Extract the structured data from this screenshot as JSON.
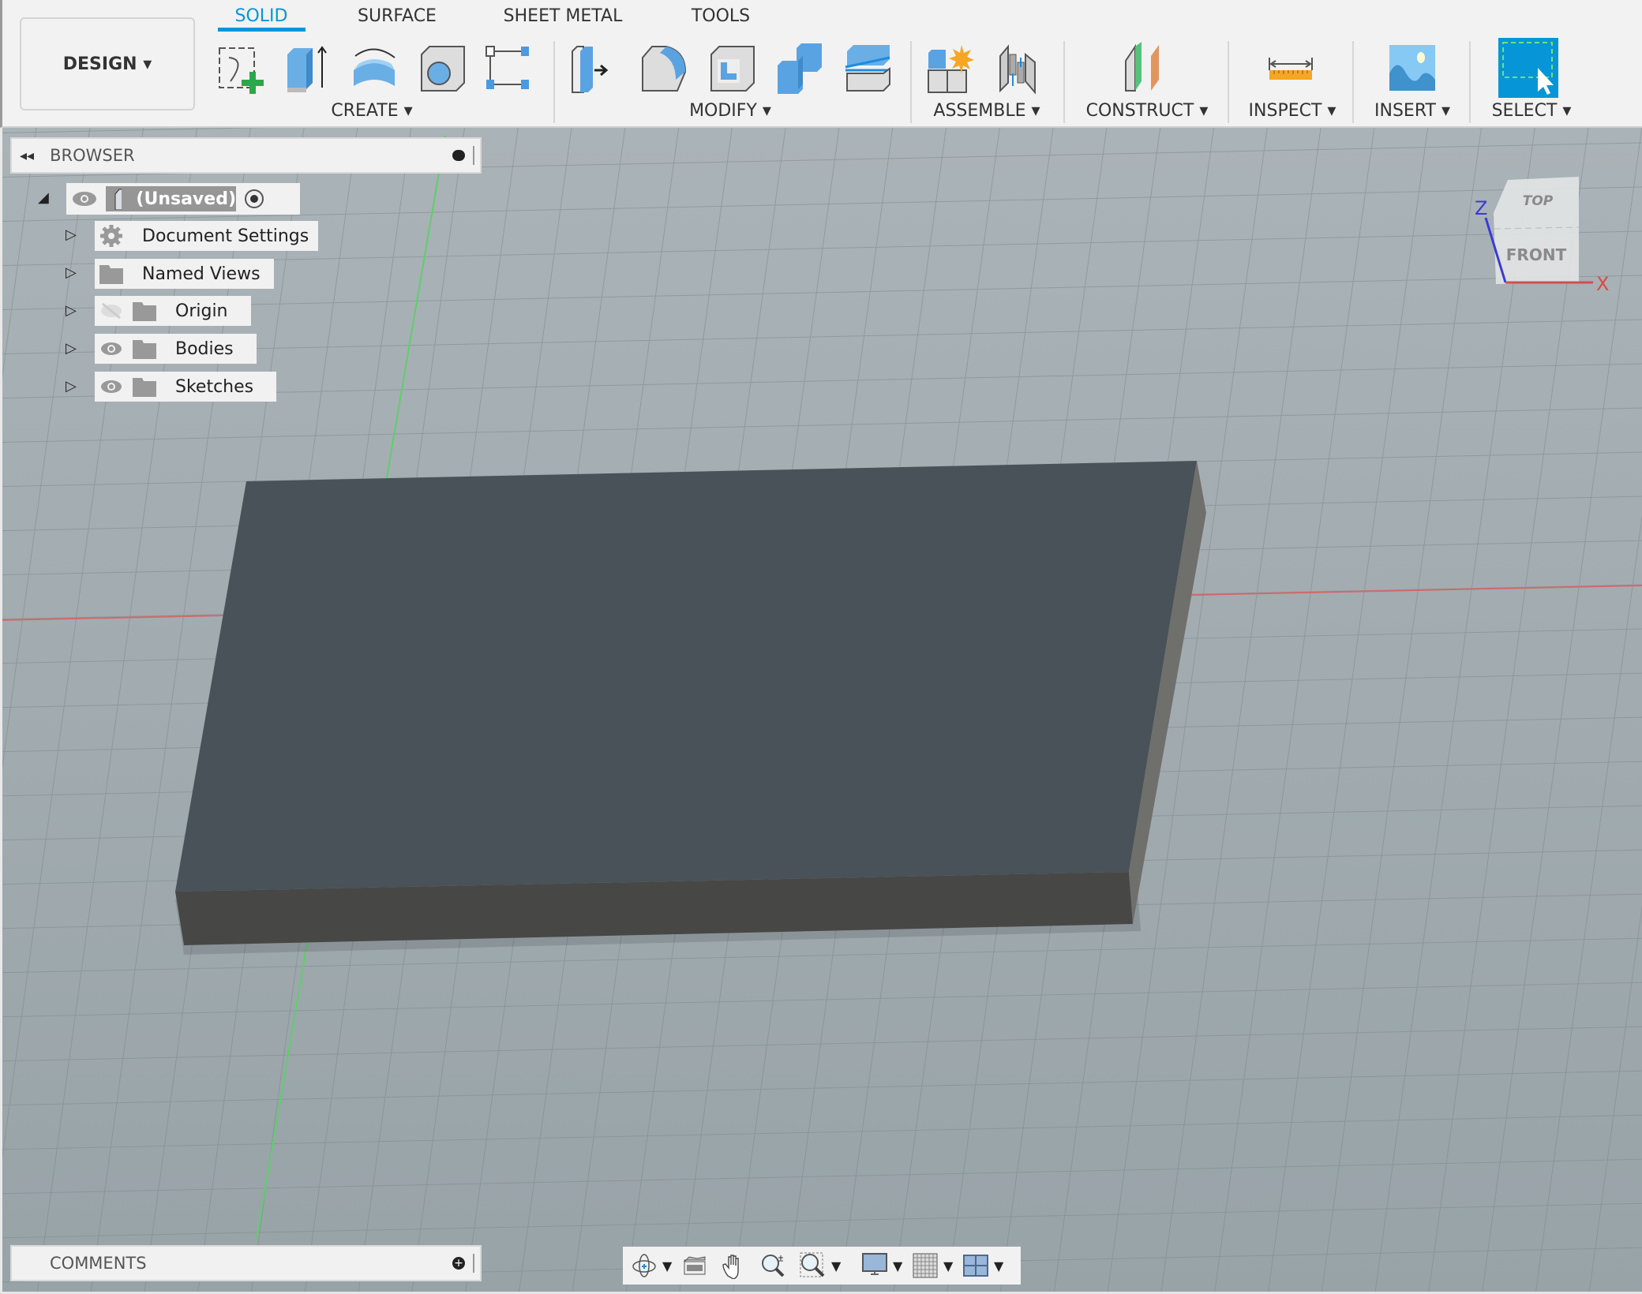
{
  "workspace": {
    "label": "DESIGN"
  },
  "tabs": [
    {
      "label": "SOLID",
      "active": true
    },
    {
      "label": "SURFACE"
    },
    {
      "label": "SHEET METAL"
    },
    {
      "label": "TOOLS"
    }
  ],
  "groups": {
    "create": "CREATE",
    "modify": "MODIFY",
    "assemble": "ASSEMBLE",
    "construct": "CONSTRUCT",
    "inspect": "INSPECT",
    "insert": "INSERT",
    "select": "SELECT"
  },
  "browser": {
    "title": "BROWSER",
    "root": "(Unsaved)",
    "items": [
      {
        "label": "Document Settings",
        "icon": "gear-icon"
      },
      {
        "label": "Named Views",
        "icon": "folder-icon"
      },
      {
        "label": "Origin",
        "icon": "folder-icon",
        "visible": false
      },
      {
        "label": "Bodies",
        "icon": "folder-icon",
        "visible": true
      },
      {
        "label": "Sketches",
        "icon": "folder-icon",
        "visible": true
      }
    ]
  },
  "comments": {
    "title": "COMMENTS"
  },
  "viewcube": {
    "top": "TOP",
    "front": "FRONT",
    "z": "Z",
    "x": "X"
  },
  "colors": {
    "accent": "#0696d7",
    "viewport": "#9aa5aa",
    "body_top": "#485258",
    "body_front": "#474745",
    "body_side": "#6f6f6c"
  }
}
